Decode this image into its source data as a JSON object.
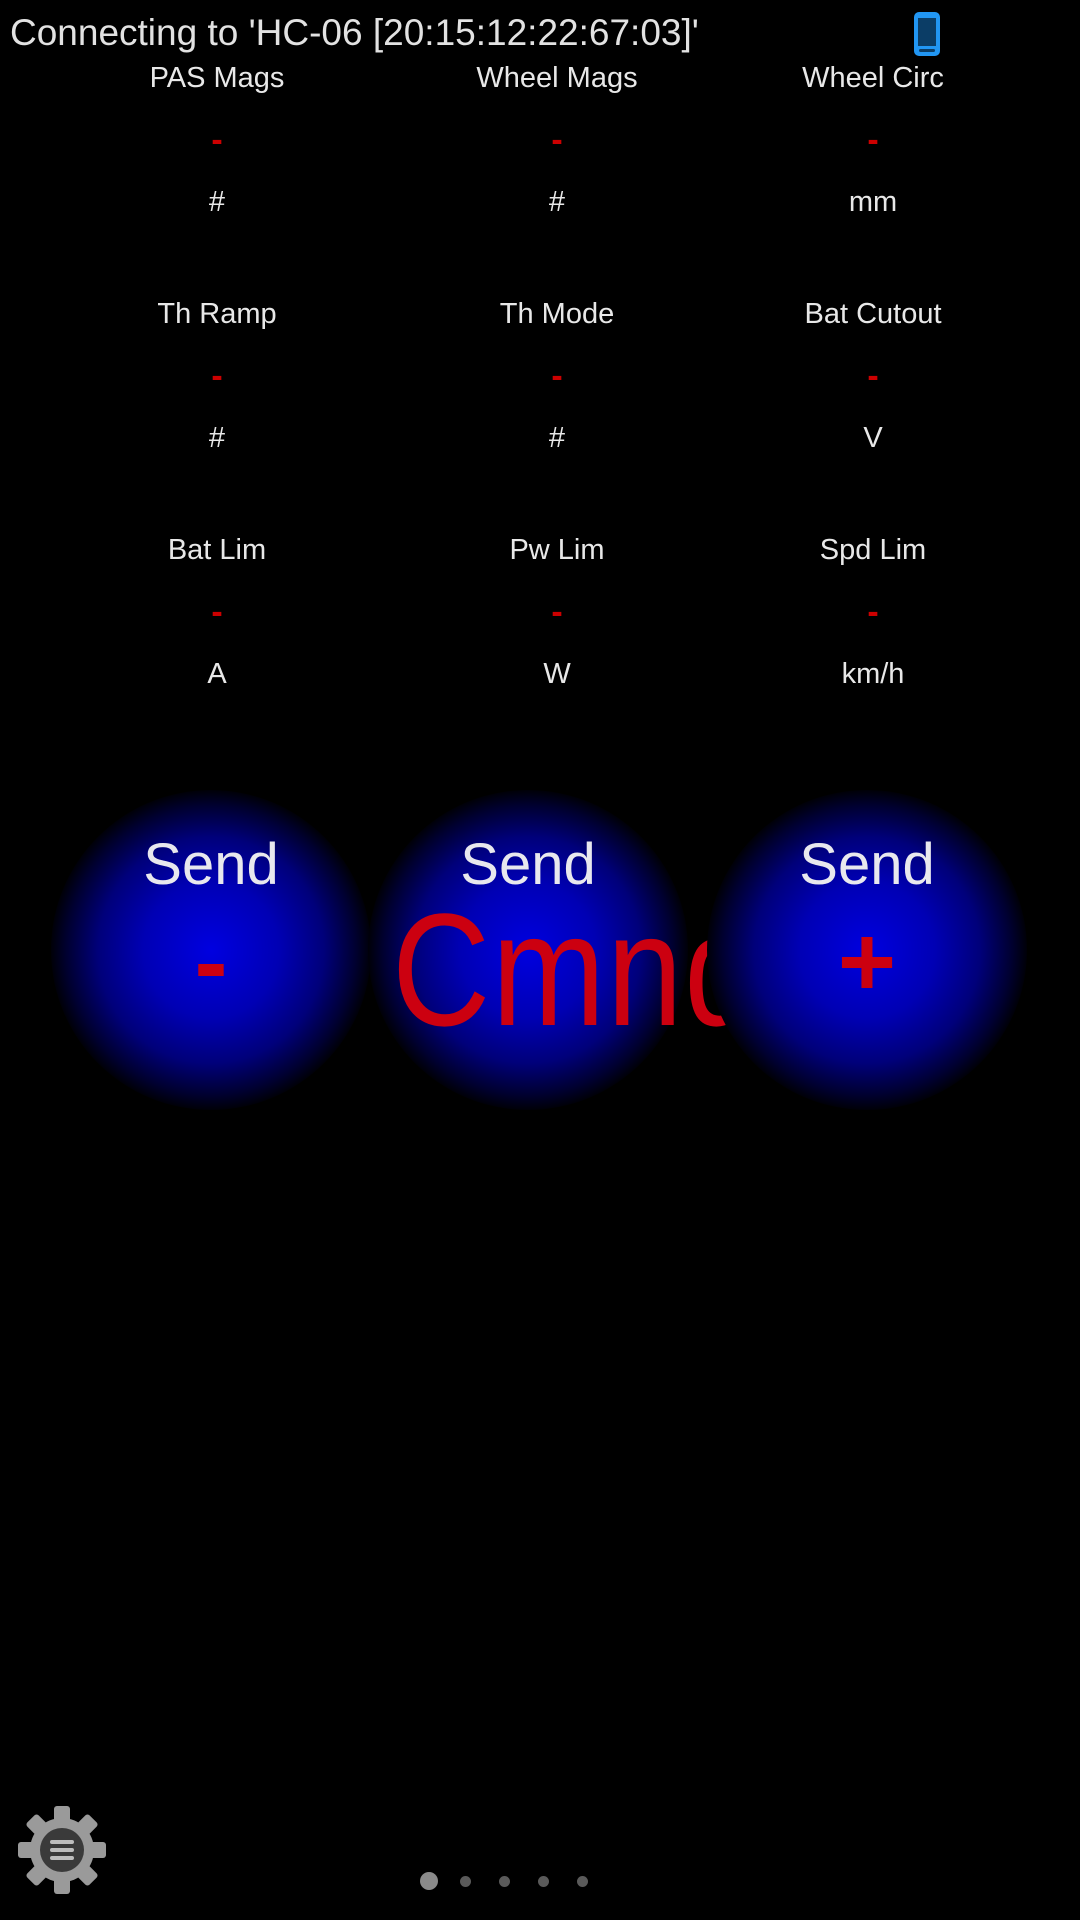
{
  "status": {
    "text": "Connecting to 'HC-06 [20:15:12:22:67:03]'",
    "icon": "phone-icon",
    "icon_color": "#2196f3"
  },
  "params": [
    [
      {
        "label": "PAS Mags",
        "value": "-",
        "unit": "#"
      },
      {
        "label": "Wheel Mags",
        "value": "-",
        "unit": "#"
      },
      {
        "label": "Wheel Circ",
        "value": "-",
        "unit": "mm"
      }
    ],
    [
      {
        "label": "Th Ramp",
        "value": "-",
        "unit": "#"
      },
      {
        "label": "Th Mode",
        "value": "-",
        "unit": "#"
      },
      {
        "label": "Bat Cutout",
        "value": "-",
        "unit": "V"
      }
    ],
    [
      {
        "label": "Bat Lim",
        "value": "-",
        "unit": "A"
      },
      {
        "label": "Pw Lim",
        "value": "-",
        "unit": "W"
      },
      {
        "label": "Spd Lim",
        "value": "-",
        "unit": "km/h"
      }
    ]
  ],
  "buttons": [
    {
      "top": "Send",
      "glyph": "-"
    },
    {
      "top": "Send",
      "glyph": "Cmnd"
    },
    {
      "top": "Send",
      "glyph": "+"
    }
  ],
  "colors": {
    "background": "#000000",
    "value_red": "#cc0000",
    "button_blue": "#0000e0",
    "label_text": "#e8e8e8"
  },
  "pager": {
    "count": 5,
    "active_index": 0
  },
  "settings": {
    "icon": "gear-icon"
  }
}
